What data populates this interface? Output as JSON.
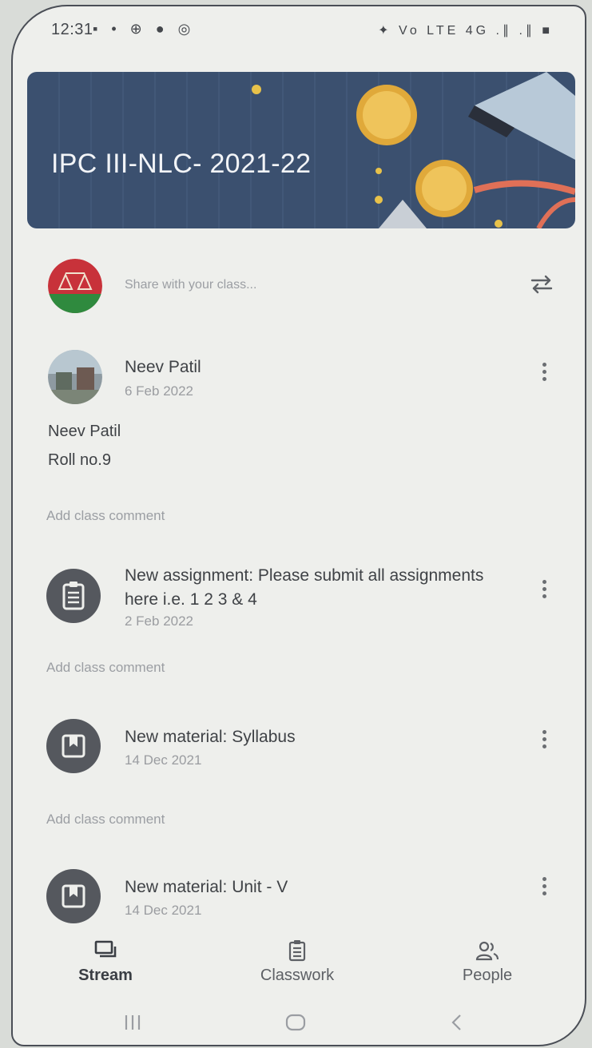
{
  "status_bar": {
    "time": "12:31",
    "left_icons": "▪ • ⊕ ● ◎",
    "right_icons": "✦ Vo LTE 4G .∥ .∥ ■"
  },
  "class": {
    "title": "IPC III-NLC- 2021-22"
  },
  "share": {
    "placeholder": "Share with your class..."
  },
  "posts": [
    {
      "author": "Neev Patil",
      "date": "6 Feb 2022",
      "body_lines": [
        "Neev Patil",
        "Roll no.9"
      ],
      "comment_label": "Add class comment"
    }
  ],
  "items": [
    {
      "type_icon": "assignment-icon",
      "title": "New assignment: Please submit all assignments here i.e. 1 2 3 & 4",
      "date": "2 Feb 2022",
      "comment_label": "Add class comment"
    },
    {
      "type_icon": "material-icon",
      "title": "New material: Syllabus",
      "date": "14 Dec 2021",
      "comment_label": "Add class comment"
    },
    {
      "type_icon": "material-icon",
      "title": "New material: Unit - V",
      "date": "14 Dec 2021"
    }
  ],
  "bottom_nav": {
    "stream": "Stream",
    "classwork": "Classwork",
    "people": "People"
  },
  "colors": {
    "banner": "#3b506f",
    "background": "#eeefec",
    "icon_circle": "#55585e"
  }
}
